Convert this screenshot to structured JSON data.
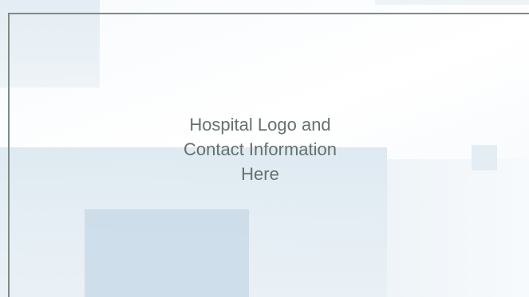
{
  "placeholder": {
    "line1": "Hospital Logo and",
    "line2": "Contact Information",
    "line3": "Here"
  },
  "colors": {
    "frame": "#7d8c86",
    "text": "#66716c",
    "shape_light_blue": "#d9e6ef",
    "shape_mid_blue": "#c9dbe8",
    "background": "#ffffff"
  }
}
